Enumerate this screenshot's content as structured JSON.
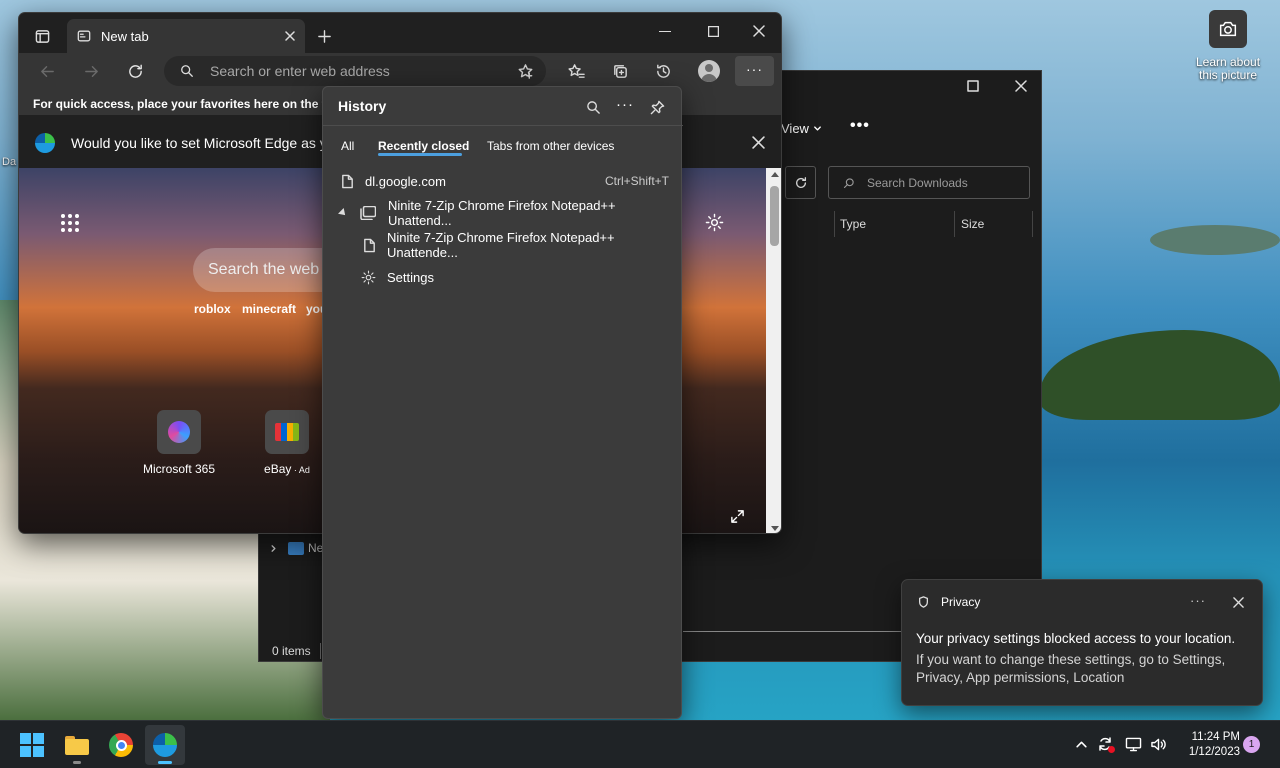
{
  "desktop": {
    "icon_label": "Learn about this picture",
    "icon_name": "camera-icon",
    "left_edge_text": "Da"
  },
  "explorer": {
    "view_label": "View",
    "search_placeholder": "Search Downloads",
    "columns": [
      "Type",
      "Size"
    ],
    "tree_item": "Ne",
    "status": "0 items"
  },
  "edge": {
    "tab_title": "New tab",
    "address_placeholder": "Search or enter web address",
    "favorites_bar_text": "For quick access, place your favorites here on the favo",
    "infobar_text": "Would you like to set Microsoft Edge as you",
    "ntp": {
      "search_placeholder": "Search the web",
      "suggestions": [
        "roblox",
        "minecraft",
        "you"
      ],
      "tiles": [
        {
          "label": "Microsoft 365",
          "ad": ""
        },
        {
          "label": "eBay",
          "ad": "Ad"
        }
      ]
    }
  },
  "history": {
    "title": "History",
    "tabs": [
      "All",
      "Recently closed",
      "Tabs from other devices"
    ],
    "active_tab": "Recently closed",
    "items": [
      {
        "label": "dl.google.com",
        "shortcut": "Ctrl+Shift+T"
      },
      {
        "label": "Ninite 7-Zip Chrome Firefox Notepad++ Unattend...",
        "shortcut": ""
      },
      {
        "label": "Ninite 7-Zip Chrome Firefox Notepad++ Unattende...",
        "shortcut": ""
      },
      {
        "label": "Settings",
        "shortcut": ""
      }
    ]
  },
  "toast": {
    "app": "Privacy",
    "title": "Your privacy settings blocked access to your location.",
    "body": "If you want to change these settings, go to Settings, Privacy, App permissions, Location"
  },
  "taskbar": {
    "time": "11:24 PM",
    "date": "1/12/2023",
    "notification_count": "1"
  },
  "colors": {
    "accent": "#4ca0e0",
    "edge_bg": "#202020",
    "history_bg": "#3b3b3b"
  }
}
